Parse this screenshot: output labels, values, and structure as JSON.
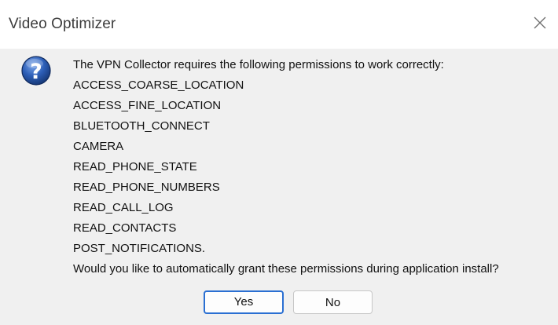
{
  "dialog": {
    "title": "Video Optimizer",
    "icon": "question-icon",
    "message_lines": [
      "The VPN Collector requires the following permissions to work correctly:",
      "ACCESS_COARSE_LOCATION",
      "ACCESS_FINE_LOCATION",
      "BLUETOOTH_CONNECT",
      "CAMERA",
      "READ_PHONE_STATE",
      "READ_PHONE_NUMBERS",
      "READ_CALL_LOG",
      "READ_CONTACTS",
      "POST_NOTIFICATIONS.",
      "Would you like to automatically grant these permissions during application install?"
    ],
    "buttons": {
      "yes": "Yes",
      "no": "No"
    }
  },
  "colors": {
    "focus_border": "#2a6fd2",
    "content_bg": "#f0f0f0",
    "icon_blue": "#2d5fb8"
  }
}
